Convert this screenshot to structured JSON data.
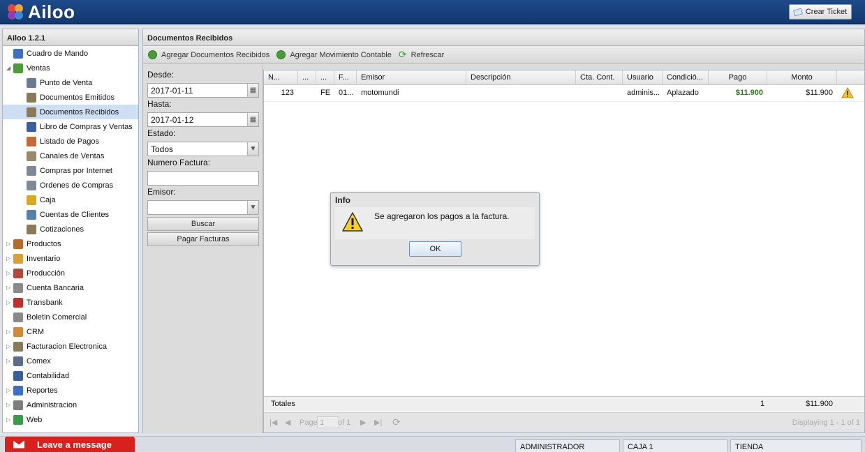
{
  "app": {
    "logo_text": "Ailoo",
    "ticket_button": "Crear Ticket"
  },
  "sidebar": {
    "title": "Ailoo 1.2.1",
    "items": [
      {
        "label": "Cuadro de Mando",
        "icon": "chart-icon",
        "level": 0,
        "color": "#3d6fc4"
      },
      {
        "label": "Ventas",
        "icon": "money-icon",
        "level": 0,
        "expanded": true,
        "color": "#4f9b3a"
      },
      {
        "label": "Punto de Venta",
        "icon": "register-icon",
        "level": 1,
        "color": "#6b7c92"
      },
      {
        "label": "Documentos Emitidos",
        "icon": "document-icon",
        "level": 1,
        "color": "#8a7a5a"
      },
      {
        "label": "Documentos Recibidos",
        "icon": "document-icon",
        "level": 1,
        "selected": true,
        "color": "#8a7a5a"
      },
      {
        "label": "Libro de Compras y Ventas",
        "icon": "book-icon",
        "level": 1,
        "color": "#3a5f9c"
      },
      {
        "label": "Listado de Pagos",
        "icon": "payments-icon",
        "level": 1,
        "color": "#c46a3a"
      },
      {
        "label": "Canales de Ventas",
        "icon": "channels-icon",
        "level": 1,
        "color": "#9a8a6a"
      },
      {
        "label": "Compras por Internet",
        "icon": "cart-icon",
        "level": 1,
        "color": "#7d8a96"
      },
      {
        "label": "Ordenes de Compras",
        "icon": "cart-icon",
        "level": 1,
        "color": "#7d8a96"
      },
      {
        "label": "Caja",
        "icon": "coins-icon",
        "level": 1,
        "color": "#d9a925"
      },
      {
        "label": "Cuentas de Clientes",
        "icon": "card-icon",
        "level": 1,
        "color": "#5a7fa8"
      },
      {
        "label": "Cotizaciones",
        "icon": "document-icon",
        "level": 1,
        "color": "#8a7a5a"
      },
      {
        "label": "Productos",
        "icon": "box-icon",
        "level": 0,
        "color": "#b86a2a"
      },
      {
        "label": "Inventario",
        "icon": "package-icon",
        "level": 0,
        "color": "#d9a035"
      },
      {
        "label": "Producción",
        "icon": "factory-icon",
        "level": 0,
        "color": "#b04a3a"
      },
      {
        "label": "Cuenta Bancaria",
        "icon": "bank-icon",
        "level": 0,
        "color": "#8a8a8a"
      },
      {
        "label": "Transbank",
        "icon": "transbank-icon",
        "level": 0,
        "color": "#c0302a"
      },
      {
        "label": "Boletin Comercial",
        "icon": "tag-icon",
        "level": 0,
        "color": "#8a8a8a",
        "no_arrow": true
      },
      {
        "label": "CRM",
        "icon": "users-icon",
        "level": 0,
        "color": "#d08a3a"
      },
      {
        "label": "Facturacion Electronica",
        "icon": "invoice-icon",
        "level": 0,
        "color": "#8a7a5a"
      },
      {
        "label": "Comex",
        "icon": "truck-icon",
        "level": 0,
        "color": "#5a6e8a"
      },
      {
        "label": "Contabilidad",
        "icon": "ledger-icon",
        "level": 0,
        "color": "#3a5f9c",
        "no_arrow": true
      },
      {
        "label": "Reportes",
        "icon": "chart-icon",
        "level": 0,
        "color": "#3d6fc4"
      },
      {
        "label": "Administracion",
        "icon": "gear-icon",
        "level": 0,
        "color": "#7d7d7d"
      },
      {
        "label": "Web",
        "icon": "globe-icon",
        "level": 0,
        "color": "#3a9a4a"
      }
    ]
  },
  "main": {
    "title": "Documentos Recibidos",
    "toolbar": {
      "add_docs": "Agregar Documentos Recibidos",
      "add_movement": "Agregar Movimiento Contable",
      "refresh": "Refrescar"
    },
    "filters": {
      "desde_label": "Desde:",
      "desde_value": "2017-01-11",
      "hasta_label": "Hasta:",
      "hasta_value": "2017-01-12",
      "estado_label": "Estado:",
      "estado_value": "Todos",
      "numero_label": "Numero Factura:",
      "numero_value": "",
      "emisor_label": "Emisor:",
      "emisor_value": "",
      "buscar": "Buscar",
      "pagar": "Pagar Facturas"
    },
    "grid": {
      "columns": [
        "N...",
        "...",
        "...",
        "F...",
        "Emisor",
        "Descripción",
        "Cta. Cont.",
        "Usuario",
        "Condició...",
        "Pago",
        "Monto"
      ],
      "row": {
        "numero": "123",
        "c2": "",
        "tipo": "FE",
        "fecha": "01...",
        "emisor": "motomundi",
        "descripcion": "",
        "cta": "",
        "usuario": "adminis...",
        "condicion": "Aplazado",
        "pago": "$11.900",
        "monto": "$11.900"
      },
      "totals": {
        "label": "Totales",
        "count": "1",
        "monto": "$11.900"
      },
      "pager": {
        "page_label": "Page",
        "page_value": "1",
        "of": "of 1",
        "displaying": "Displaying 1 - 1 of 1"
      }
    }
  },
  "dialog": {
    "title": "Info",
    "message": "Se agregaron los pagos a la factura.",
    "ok": "OK"
  },
  "statusbar": {
    "leave_message": "Leave a message",
    "user": "ADMINISTRADOR",
    "caja": "CAJA 1",
    "tienda": "TIENDA"
  },
  "colors": {
    "header_bg": "#163f7c",
    "selected_row": "#cfdff3",
    "pago_green": "#2a7a1a",
    "leave_red": "#d8201c"
  }
}
